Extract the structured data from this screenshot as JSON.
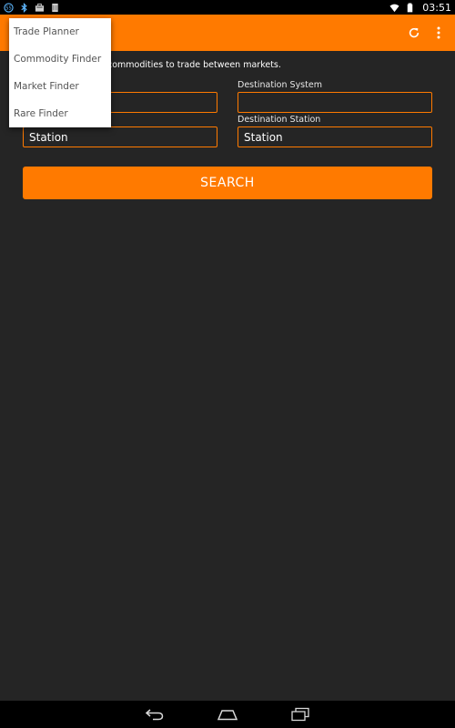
{
  "status_bar": {
    "time": "03:51",
    "left_icons": [
      "app-notification-icon",
      "bluetooth-icon",
      "briefcase-icon",
      "sim-icon"
    ],
    "right_icons": [
      "wifi-icon",
      "battery-icon"
    ]
  },
  "action_bar": {
    "color": "#ff7a00",
    "actions": [
      "refresh-icon",
      "overflow-menu-icon"
    ]
  },
  "menu": {
    "items": [
      {
        "label": "Trade Planner"
      },
      {
        "label": "Commodity Finder"
      },
      {
        "label": "Market Finder"
      },
      {
        "label": "Rare Finder"
      }
    ]
  },
  "main": {
    "instruction_visible": "commodities to trade between markets.",
    "destination_system_label": "Destination System",
    "destination_station_label": "Destination Station",
    "source_system": {
      "value": "",
      "placeholder": ""
    },
    "source_station": {
      "value": "",
      "placeholder": "Station"
    },
    "destination_system": {
      "value": "",
      "placeholder": ""
    },
    "destination_station": {
      "value": "",
      "placeholder": "Station"
    },
    "search_label": "SEARCH"
  },
  "nav_bar": {
    "buttons": [
      "back-icon",
      "home-icon",
      "recents-icon"
    ]
  }
}
